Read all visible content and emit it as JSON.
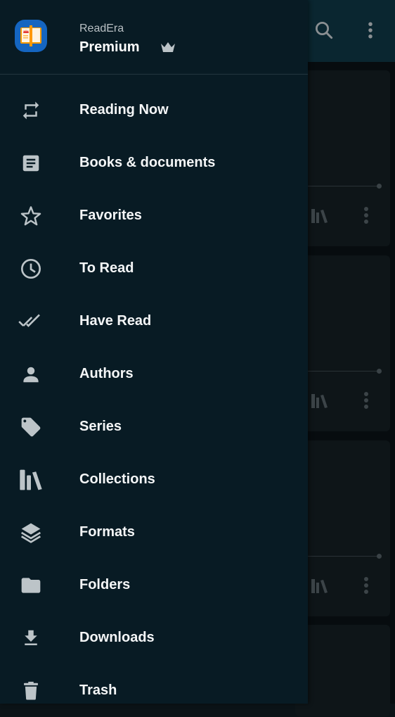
{
  "app": {
    "name": "ReadEra",
    "tier": "Premium"
  },
  "appbar": {
    "icons": [
      "search-icon",
      "more-vert-icon"
    ]
  },
  "drawer": {
    "items": [
      {
        "label": "Reading Now",
        "icon": "repeat-icon"
      },
      {
        "label": "Books & documents",
        "icon": "document-icon"
      },
      {
        "label": "Favorites",
        "icon": "star-icon"
      },
      {
        "label": "To Read",
        "icon": "clock-icon"
      },
      {
        "label": "Have Read",
        "icon": "double-check-icon"
      },
      {
        "label": "Authors",
        "icon": "person-icon"
      },
      {
        "label": "Series",
        "icon": "tag-icon"
      },
      {
        "label": "Collections",
        "icon": "books-shelf-icon"
      },
      {
        "label": "Formats",
        "icon": "layers-icon"
      },
      {
        "label": "Folders",
        "icon": "folder-icon"
      },
      {
        "label": "Downloads",
        "icon": "download-icon"
      },
      {
        "label": "Trash",
        "icon": "trash-icon"
      }
    ]
  },
  "colors": {
    "drawer_bg": "#081b24",
    "appbar_bg": "#0a2630",
    "icon": "#bcc4c8",
    "logo_bg": "#1565c0",
    "logo_book": "#ff9800"
  }
}
